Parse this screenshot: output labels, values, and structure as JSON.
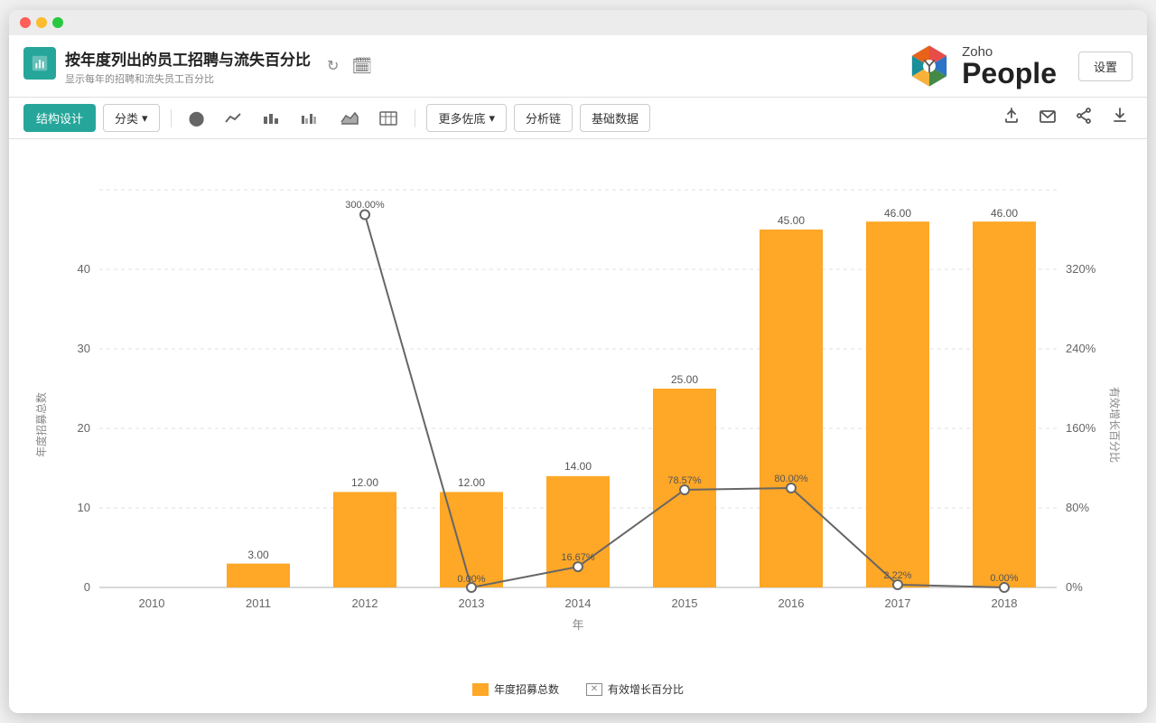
{
  "window": {
    "dots": [
      "red",
      "yellow",
      "green"
    ]
  },
  "header": {
    "icon_color": "#26a69a",
    "main_title": "按年度列出的员工招聘与流失百分比",
    "subtitle": "显示每年的招聘和流失员工百分比",
    "refresh_icon": "↻",
    "calendar_icon": "📅"
  },
  "logo": {
    "zoho": "Zoho",
    "people": "People"
  },
  "settings_label": "设置",
  "toolbar": {
    "design_label": "结构设计",
    "sort_label": "分类",
    "more_options_label": "更多佐底",
    "share_label": "分析链",
    "raw_data_label": "基础数据"
  },
  "chart": {
    "title": "按年度列出的员工招聘与流失百分比",
    "x_axis_label": "年",
    "y_axis_left_label": "年度招募总数",
    "y_axis_right_label": "有效增长百分比",
    "left_y_ticks": [
      0,
      10,
      20,
      30,
      40
    ],
    "right_y_ticks": [
      "0%",
      "80%",
      "160%",
      "240%",
      "320%"
    ],
    "bars": [
      {
        "year": "2010",
        "value": 0,
        "label": null
      },
      {
        "year": "2011",
        "value": 3,
        "label": "3.00"
      },
      {
        "year": "2012",
        "value": 12,
        "label": "12.00"
      },
      {
        "year": "2013",
        "value": 12,
        "label": "12.00"
      },
      {
        "year": "2014",
        "value": 14,
        "label": "14.00"
      },
      {
        "year": "2015",
        "value": 25,
        "label": "25.00"
      },
      {
        "year": "2016",
        "value": 45,
        "label": "45.00"
      },
      {
        "year": "2017",
        "value": 46,
        "label": "46.00"
      },
      {
        "year": "2018",
        "value": 46,
        "label": "46.00"
      }
    ],
    "line_points": [
      {
        "year": "2010",
        "pct": null,
        "label": null
      },
      {
        "year": "2011",
        "pct": null,
        "label": null
      },
      {
        "year": "2012",
        "pct": 300,
        "label": "300.00%"
      },
      {
        "year": "2013",
        "pct": 0,
        "label": "0.00%"
      },
      {
        "year": "2014",
        "pct": 16.67,
        "label": "16.67%"
      },
      {
        "year": "2015",
        "pct": 78.57,
        "label": "78.57%"
      },
      {
        "year": "2016",
        "pct": 80,
        "label": "80.00%"
      },
      {
        "year": "2017",
        "pct": 2.22,
        "label": "2.22%"
      },
      {
        "year": "2018",
        "pct": 0,
        "label": "0.00%"
      }
    ],
    "legend": {
      "bar_label": "年度招募总数",
      "line_label": "有效增长百分比"
    }
  }
}
